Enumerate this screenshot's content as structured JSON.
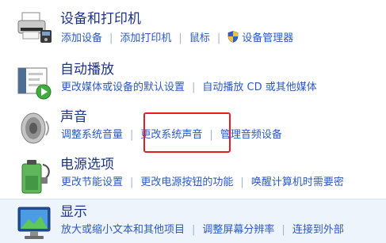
{
  "categories": [
    {
      "title": "设备和打印机",
      "icon": "printer-icon",
      "links": [
        {
          "label": "添加设备"
        },
        {
          "label": "添加打印机"
        },
        {
          "label": "鼠标"
        },
        {
          "label": "设备管理器",
          "icon": "shield-icon"
        }
      ]
    },
    {
      "title": "自动播放",
      "icon": "autoplay-icon",
      "links": [
        {
          "label": "更改媒体或设备的默认设置"
        },
        {
          "label": "自动播放 CD 或其他媒体"
        }
      ]
    },
    {
      "title": "声音",
      "icon": "speaker-icon",
      "links": [
        {
          "label": "调整系统音量"
        },
        {
          "label": "更改系统声音"
        },
        {
          "label": "管理音频设备"
        }
      ]
    },
    {
      "title": "电源选项",
      "icon": "power-options-icon",
      "links": [
        {
          "label": "更改节能设置"
        },
        {
          "label": "更改电源按钮的功能"
        },
        {
          "label": "唤醒计算机时需要密"
        }
      ]
    },
    {
      "title": "显示",
      "icon": "display-icon",
      "links": [
        {
          "label": "放大或缩小文本和其他项目"
        },
        {
          "label": "调整屏幕分辨率"
        },
        {
          "label": "连接到外部"
        }
      ]
    }
  ],
  "colors": {
    "title": "#1e3287",
    "link": "#2b59c3",
    "separator": "#9eb4d8",
    "highlight_box": "#e31e24",
    "selected_row_background": "#eef4fc"
  }
}
